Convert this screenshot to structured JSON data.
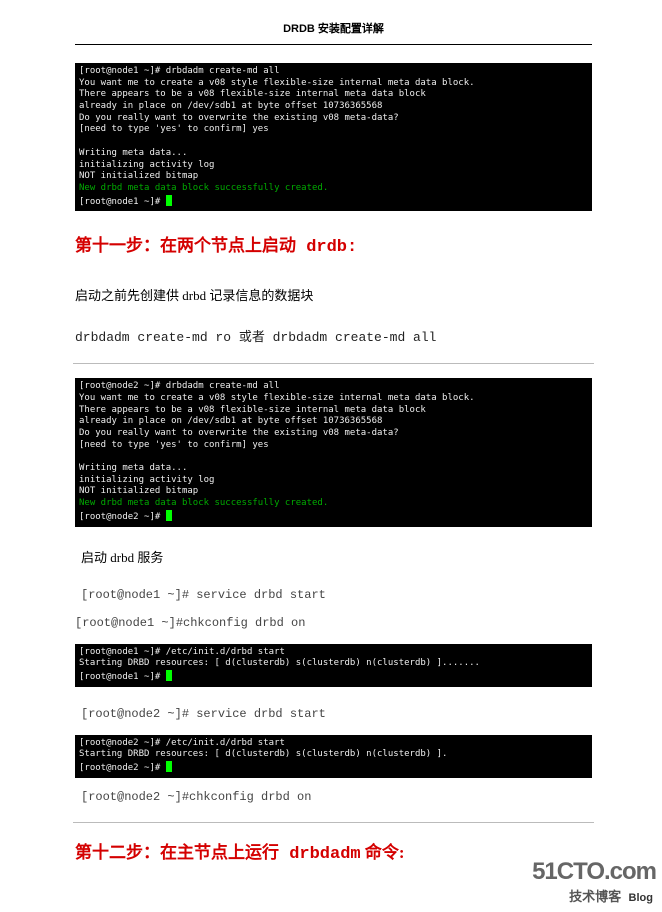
{
  "doc": {
    "title": "DRDB 安装配置详解"
  },
  "terminal1": {
    "line1": "[root@node1 ~]# drbdadm create-md all",
    "line2": "You want me to create a v08 style flexible-size internal meta data block.",
    "line3": "There appears to be a v08 flexible-size internal meta data block",
    "line4": "already in place on /dev/sdb1 at byte offset 10736365568",
    "line5": "Do you really want to overwrite the existing v08 meta-data?",
    "line6": "[need to type 'yes' to confirm] yes",
    "line7": "",
    "line8": "Writing meta data...",
    "line9": "initializing activity log",
    "line10": "NOT initialized bitmap",
    "line11_green": "New drbd meta data block successfully created.",
    "line12": "[root@node1 ~]# "
  },
  "step11": {
    "heading_prefix": "第十一步：在两个节点上启动",
    "heading_code": " drdb:",
    "desc": "启动之前先创建供 drbd 记录信息的数据块",
    "cmd": "drbdadm create-md ro 或者 drbdadm create-md all"
  },
  "terminal2": {
    "line1": "[root@node2 ~]# drbdadm create-md all",
    "line2": "You want me to create a v08 style flexible-size internal meta data block.",
    "line3": "There appears to be a v08 flexible-size internal meta data block",
    "line4": "already in place on /dev/sdb1 at byte offset 10736365568",
    "line5": "Do you really want to overwrite the existing v08 meta-data?",
    "line6": "[need to type 'yes' to confirm] yes",
    "line7": "",
    "line8": "Writing meta data...",
    "line9": "initializing activity log",
    "line10": "NOT initialized bitmap",
    "line11_green": "New drbd meta data block successfully created.",
    "line12": "[root@node2 ~]# "
  },
  "svc": {
    "desc": "启动 drbd 服务",
    "cmd1": "[root@node1 ~]# service drbd start",
    "cmd2": "[root@node1 ~]#chkconfig drbd on"
  },
  "terminal3": {
    "line1": "[root@node1 ~]# /etc/init.d/drbd start",
    "line2": "Starting DRBD resources: [ d(clusterdb) s(clusterdb) n(clusterdb) ].......",
    "line3": "[root@node1 ~]# "
  },
  "svc2": {
    "cmd": "[root@node2 ~]# service drbd start"
  },
  "terminal4": {
    "line1": "[root@node2 ~]# /etc/init.d/drbd start",
    "line2": "Starting DRBD resources: [ d(clusterdb) s(clusterdb) n(clusterdb) ].",
    "line3": "[root@node2 ~]# "
  },
  "svc3": {
    "cmd": "[root@node2 ~]#chkconfig drbd on"
  },
  "step12": {
    "heading_prefix": "第十二步：在主节点上运行",
    "heading_code": " drbdadm",
    "heading_suffix": " 命令:"
  },
  "watermark": {
    "url": "51CTO.com",
    "sub": "技术博客",
    "blog": "Blog"
  }
}
